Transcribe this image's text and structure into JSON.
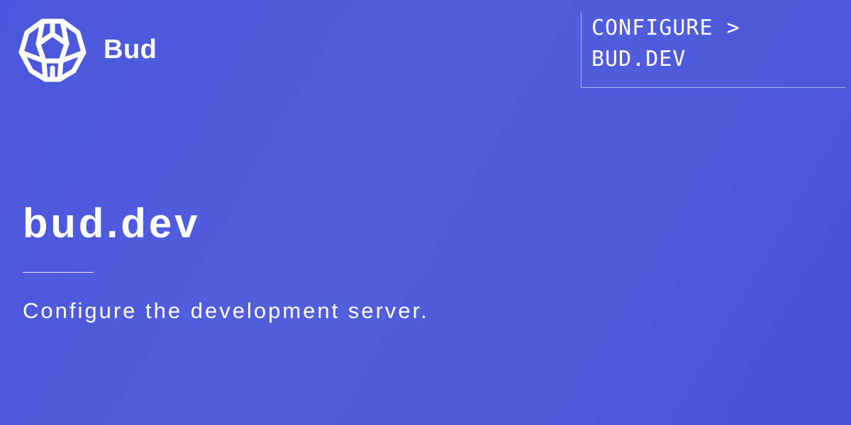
{
  "brand": {
    "logo_icon": "honeycomb-logo-icon",
    "name": "Bud"
  },
  "breadcrumb": {
    "line1": "CONFIGURE >",
    "line2": "BUD.DEV"
  },
  "page": {
    "title": "bud.dev",
    "subtitle": "Configure the development server."
  },
  "colors": {
    "background": "#4f5bdc",
    "text": "#ffffff"
  }
}
